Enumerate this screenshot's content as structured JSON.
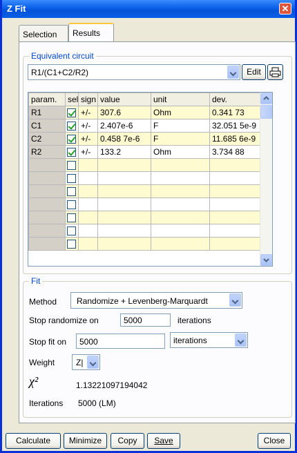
{
  "window": {
    "title": "Z Fit"
  },
  "tabs": [
    {
      "label": "Selection"
    },
    {
      "label": "Results"
    }
  ],
  "circuit": {
    "group_title": "Equivalent circuit",
    "value": "R1/(C1+C2/R2)",
    "edit_label": "Edit"
  },
  "table": {
    "headers": [
      "param.",
      "sel.",
      "sign",
      "value",
      "unit",
      "dev."
    ],
    "rows": [
      {
        "param": "R1",
        "sel": true,
        "sign": "+/-",
        "value": "307.6",
        "unit": "Ohm",
        "dev": "0.341 73"
      },
      {
        "param": "C1",
        "sel": true,
        "sign": "+/-",
        "value": "2.407e-6",
        "unit": "F",
        "dev": "32.051 5e-9"
      },
      {
        "param": "C2",
        "sel": true,
        "sign": "+/-",
        "value": "0.458 7e-6",
        "unit": "F",
        "dev": "11.685 6e-9"
      },
      {
        "param": "R2",
        "sel": true,
        "sign": "+/-",
        "value": "133.2",
        "unit": "Ohm",
        "dev": "3.734 88"
      },
      {
        "param": "",
        "sel": false,
        "sign": "",
        "value": "",
        "unit": "",
        "dev": ""
      },
      {
        "param": "",
        "sel": false,
        "sign": "",
        "value": "",
        "unit": "",
        "dev": ""
      },
      {
        "param": "",
        "sel": false,
        "sign": "",
        "value": "",
        "unit": "",
        "dev": ""
      },
      {
        "param": "",
        "sel": false,
        "sign": "",
        "value": "",
        "unit": "",
        "dev": ""
      },
      {
        "param": "",
        "sel": false,
        "sign": "",
        "value": "",
        "unit": "",
        "dev": ""
      },
      {
        "param": "",
        "sel": false,
        "sign": "",
        "value": "",
        "unit": "",
        "dev": ""
      },
      {
        "param": "",
        "sel": false,
        "sign": "",
        "value": "",
        "unit": "",
        "dev": ""
      }
    ]
  },
  "fit": {
    "group_title": "Fit",
    "method_label": "Method",
    "method_value": "Randomize + Levenberg-Marquardt",
    "stop_randomize_label": "Stop randomize on",
    "stop_randomize_value": "5000",
    "stop_randomize_unit": "iterations",
    "stop_fit_label": "Stop fit on",
    "stop_fit_value": "5000",
    "stop_fit_unit": "iterations",
    "weight_label": "Weight",
    "weight_value": "Z|",
    "chi_label": "χ²",
    "chi_value": "1.13221097194042",
    "iterations_label": "Iterations",
    "iterations_value": "5000 (LM)"
  },
  "buttons": {
    "calculate": "Calculate",
    "minimize": "Minimize",
    "copy": "Copy",
    "save": "Save",
    "close": "Close"
  }
}
